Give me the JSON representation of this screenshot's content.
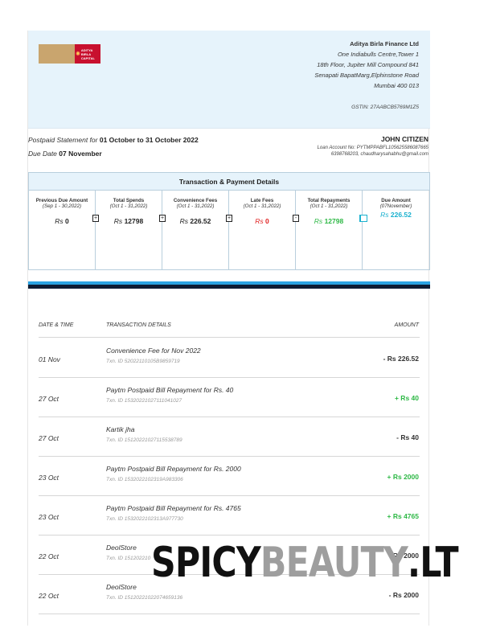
{
  "header": {
    "logo_text": "ADITYA BIRLA CAPITAL",
    "company": "Aditya Birla Finance Ltd",
    "address": [
      "One Indiabulls Centre,Tower 1",
      "18th Floor, Jupiter Mill Compound 841",
      "Senapati BapatMarg,Elphinstone Road",
      "Mumbai 400 013"
    ],
    "gstin": "GSTIN:  27AABCB5769M1Z5"
  },
  "statement": {
    "period_label": "Postpaid Statement for",
    "period": "01 October to 31 October 2022",
    "due_label": "Due Date",
    "due_date": "07 November"
  },
  "customer": {
    "name": "JOHN CITIZEN",
    "loan_line": "Loan Account No:  PYTMPPABFL105625586087665",
    "contact_line": "6398768203,   chaudharysahabhu@gmail.com"
  },
  "summary": {
    "title": "Transaction & Payment Details",
    "cells": [
      {
        "label": "Previous Due Amount",
        "sub": "(Sep 1 - 30,2022)",
        "currency": "Rs",
        "value": "0",
        "op": ""
      },
      {
        "label": "Total Spends",
        "sub": "(Oct 1 - 31,2022)",
        "currency": "Rs",
        "value": "12798",
        "op": "+"
      },
      {
        "label": "Convenience Fees",
        "sub": "(Oct 1 - 31,2022)",
        "currency": "Rs",
        "value": "226.52",
        "op": "+"
      },
      {
        "label": "Late Fees",
        "sub": "(Oct 1 - 31,2022)",
        "currency": "Rs",
        "value": "0",
        "op": "+"
      },
      {
        "label": "Total Repayments",
        "sub": "(Oct 1 - 31,2022)",
        "currency": "Rs",
        "value": "12798",
        "op": "-"
      },
      {
        "label": "Due Amount",
        "sub": "(07November)",
        "currency": "Rs",
        "value": "226.52",
        "op": ""
      }
    ]
  },
  "table": {
    "headers": [
      "DATE & TIME",
      "TRANSACTION DETAILS",
      "AMOUNT"
    ],
    "rows": [
      {
        "date": "01 Nov",
        "desc": "Convenience Fee for Nov 2022",
        "txn": "Txn. ID 52022110105B9859719",
        "amount": "- Rs 226.52"
      },
      {
        "date": "27 Oct",
        "desc": "Paytm Postpaid Bill Repayment for Rs. 40",
        "txn": "Txn. ID 15320221027111041027",
        "amount": "+ Rs 40"
      },
      {
        "date": "27 Oct",
        "desc": "Kartik jha",
        "txn": "Txn. ID 15120221027115538789",
        "amount": "- Rs 40"
      },
      {
        "date": "23 Oct",
        "desc": "Paytm Postpaid Bill Repayment for Rs. 2000",
        "txn": "Txn. ID 1532022102319A983306",
        "amount": "+ Rs 2000"
      },
      {
        "date": "23 Oct",
        "desc": "Paytm Postpaid Bill Repayment for Rs. 4765",
        "txn": "Txn. ID 1532022102313A977730",
        "amount": "+ Rs 4765"
      },
      {
        "date": "22 Oct",
        "desc": "DeolStore",
        "txn": "Txn. ID 151202210",
        "amount": "Rs 2000"
      },
      {
        "date": "22 Oct",
        "desc": "DeolStore",
        "txn": "Txn. ID 15120221022074659136",
        "amount": "- Rs 2000"
      }
    ]
  },
  "watermark": {
    "part1": "SPICY",
    "part2": "BEAUTY",
    "part3": ".LT"
  }
}
